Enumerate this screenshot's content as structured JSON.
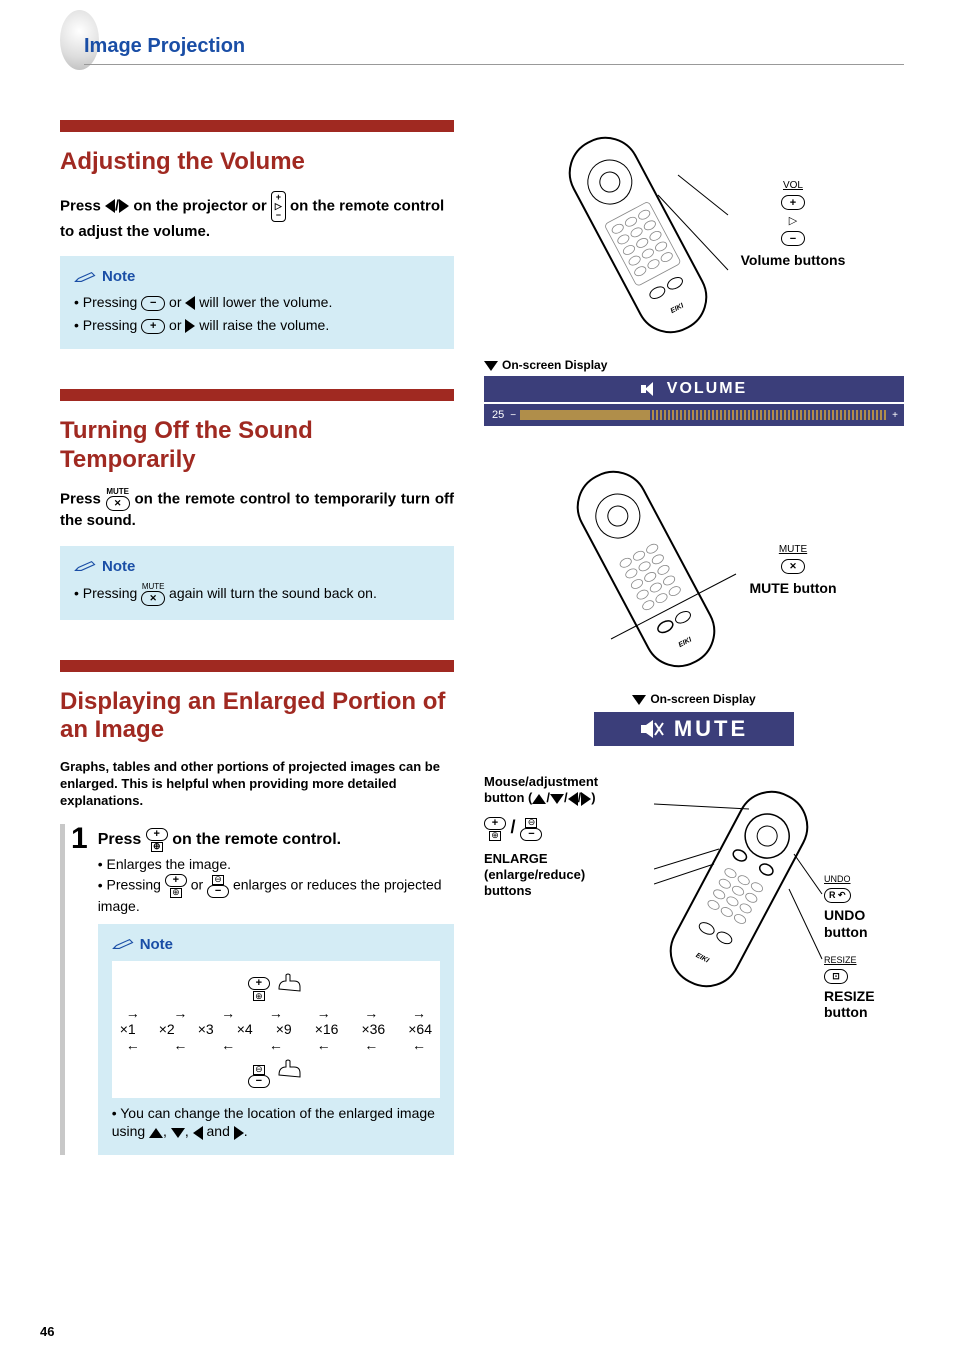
{
  "breadcrumb": "Image Projection",
  "page_number": "46",
  "sections": {
    "volume": {
      "title": "Adjusting the Volume",
      "instr_pre": "Press",
      "instr_mid": "on the projector or",
      "instr_post": "on the remote control to adjust the volume.",
      "note_label": "Note",
      "note_line1a": "Pressing",
      "note_line1b": "or",
      "note_line1c": "will lower the volume.",
      "note_line2a": "Pressing",
      "note_line2b": "or",
      "note_line2c": "will raise the volume."
    },
    "mute": {
      "title": "Turning Off the Sound Temporarily",
      "instr_pre": "Press",
      "instr_post": "on the remote control to temporarily turn off the sound.",
      "note_label": "Note",
      "note_a": "Pressing",
      "note_b": "again will turn the sound back on.",
      "mute_btn_label": "MUTE"
    },
    "enlarge": {
      "title": "Displaying an Enlarged Portion of an Image",
      "desc": "Graphs, tables and other portions of projected images can be enlarged. This is helpful when providing more detailed explanations.",
      "step1_num": "1",
      "step1_instr_a": "Press",
      "step1_instr_b": "on the remote control.",
      "step1_bullet1": "Enlarges the image.",
      "step1_bullet2a": "Pressing",
      "step1_bullet2b": "or",
      "step1_bullet2c": "enlarges or reduces the projected image.",
      "note_label": "Note",
      "zoom_levels": [
        "×1",
        "×2",
        "×3",
        "×4",
        "×9",
        "×16",
        "×36",
        "×64"
      ],
      "note2_a": "You can change the location of the enlarged image using",
      "note2_b": "and",
      "note2_c": "."
    }
  },
  "right": {
    "vol_label_top": "VOL",
    "vol_buttons_label": "Volume buttons",
    "osd_label": "On-screen Display",
    "osd_volume": "VOLUME",
    "osd_level": "25",
    "mute_btn_top": "MUTE",
    "mute_button_label": "MUTE button",
    "osd_mute": "MUTE",
    "r3_mouse_a": "Mouse/adjustment",
    "r3_mouse_b": "button (",
    "r3_mouse_c": ")",
    "r3_enlarge_a": "ENLARGE",
    "r3_enlarge_b": "(enlarge/reduce)",
    "r3_enlarge_c": "buttons",
    "r3_undo_top": "UNDO",
    "r3_undo": "UNDO button",
    "r3_resize_top": "RESIZE",
    "r3_resize": "RESIZE button",
    "slash": " / "
  }
}
